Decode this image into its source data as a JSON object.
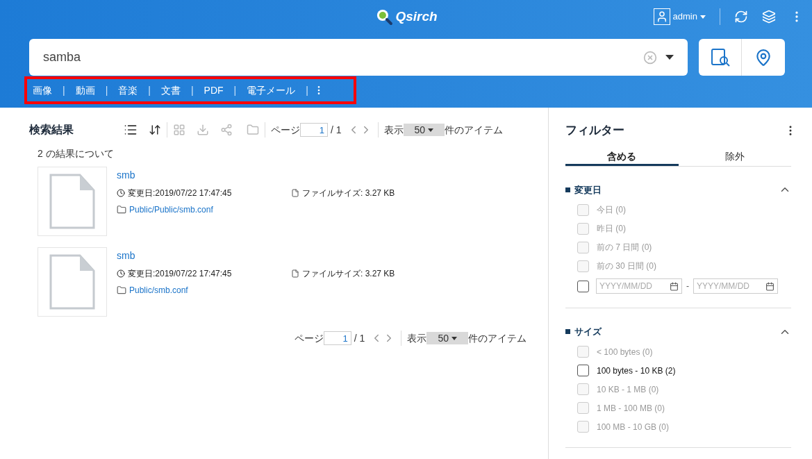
{
  "header": {
    "logo": "Qsirch",
    "user": "admin"
  },
  "search": {
    "value": "samba"
  },
  "categories": {
    "separator": "|",
    "items": [
      "画像",
      "動画",
      "音楽",
      "文書",
      "PDF",
      "電子メール"
    ]
  },
  "results": {
    "title": "検索結果",
    "pager_top": {
      "label": "ページ",
      "page": "1",
      "total": "/ 1",
      "show": "表示",
      "per_page": "50",
      "suffix": "件のアイテム"
    },
    "count": "2 の結果について",
    "items": [
      {
        "name": "smb",
        "modified": "変更日:2019/07/22 17:47:45",
        "size": "ファイルサイズ: 3.27 KB",
        "path": "Public/Public/smb.conf"
      },
      {
        "name": "smb",
        "modified": "変更日:2019/07/22 17:47:45",
        "size": "ファイルサイズ: 3.27 KB",
        "path": "Public/smb.conf"
      }
    ],
    "pager_bottom": {
      "label": "ページ",
      "page": "1",
      "total": "/ 1",
      "show": "表示",
      "per_page": "50",
      "suffix": "件のアイテム"
    }
  },
  "filter": {
    "title": "フィルター",
    "tabs": [
      {
        "label": "含める",
        "selected": true
      },
      {
        "label": "除外",
        "selected": false
      }
    ],
    "sections": [
      {
        "title": "変更日",
        "expanded": true,
        "options": [
          {
            "label": "今日 (0)",
            "disabled": true,
            "checked": false
          },
          {
            "label": "昨日 (0)",
            "disabled": true,
            "checked": false
          },
          {
            "label": "前の 7 日間 (0)",
            "disabled": true,
            "checked": false
          },
          {
            "label": "前の 30 日間 (0)",
            "disabled": true,
            "checked": false
          }
        ],
        "range": {
          "checked": false,
          "from_placeholder": "YYYY/MM/DD",
          "separator": "-",
          "to_placeholder": "YYYY/MM/DD"
        }
      },
      {
        "title": "サイズ",
        "expanded": true,
        "options": [
          {
            "label": "< 100 bytes (0)",
            "disabled": true,
            "checked": false
          },
          {
            "label": "100 bytes - 10 KB (2)",
            "disabled": false,
            "checked": false
          },
          {
            "label": "10 KB - 1 MB (0)",
            "disabled": true,
            "checked": false
          },
          {
            "label": "1 MB - 100 MB (0)",
            "disabled": true,
            "checked": false
          },
          {
            "label": "100 MB - 10 GB (0)",
            "disabled": true,
            "checked": false
          }
        ]
      }
    ]
  }
}
